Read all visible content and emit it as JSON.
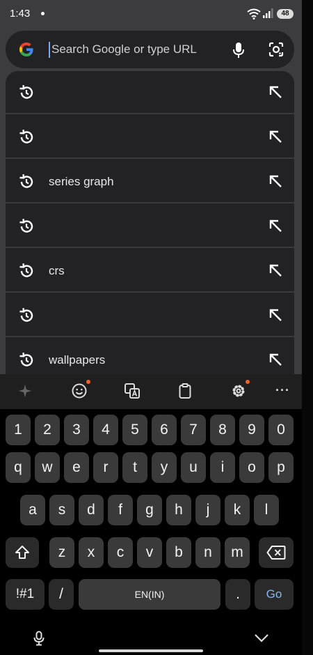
{
  "status": {
    "time": "1:43",
    "battery": "48"
  },
  "search": {
    "placeholder": "Search Google or type URL"
  },
  "suggestions": [
    {
      "text": ""
    },
    {
      "text": ""
    },
    {
      "text": "series graph"
    },
    {
      "text": ""
    },
    {
      "text": "crs"
    },
    {
      "text": ""
    },
    {
      "text": "wallpapers"
    }
  ],
  "toolbar": {
    "items": [
      "sparkle-icon",
      "emoji-icon",
      "translate-icon",
      "clipboard-icon",
      "settings-icon",
      "more-icon"
    ],
    "more": "···"
  },
  "keyboard": {
    "row_numbers": [
      "1",
      "2",
      "3",
      "4",
      "5",
      "6",
      "7",
      "8",
      "9",
      "0"
    ],
    "row_top": [
      "q",
      "w",
      "e",
      "r",
      "t",
      "y",
      "u",
      "i",
      "o",
      "p"
    ],
    "row_mid": [
      "a",
      "s",
      "d",
      "f",
      "g",
      "h",
      "j",
      "k",
      "l"
    ],
    "row_bottom": [
      "z",
      "x",
      "c",
      "v",
      "b",
      "n",
      "m"
    ],
    "symbols_label": "!#1",
    "slash_label": "/",
    "space_label": "EN(IN)",
    "period_label": ".",
    "go_label": "Go"
  },
  "colors": {
    "accent": "#7aa7f7",
    "go": "#8ab4f8",
    "badge": "#f0642c"
  }
}
